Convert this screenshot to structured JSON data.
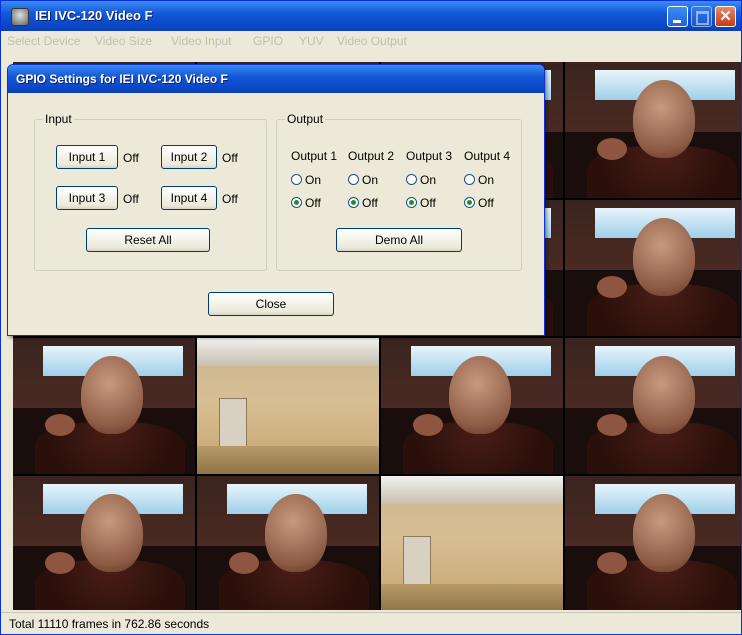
{
  "window": {
    "title": "IEI IVC-120 Video F",
    "close_glyph": "✕"
  },
  "menubar": {
    "items": [
      "Select Device",
      "Video Size",
      "Video Input",
      "GPIO",
      "YUV",
      "Video Output"
    ]
  },
  "dialog": {
    "title": "GPIO Settings for IEI IVC-120 Video F",
    "input_group_label": "Input",
    "output_group_label": "Output",
    "inputs": [
      {
        "label": "Input 1",
        "state": "Off"
      },
      {
        "label": "Input 2",
        "state": "Off"
      },
      {
        "label": "Input 3",
        "state": "Off"
      },
      {
        "label": "Input 4",
        "state": "Off"
      }
    ],
    "reset_all_label": "Reset All",
    "outputs": [
      {
        "label": "Output 1",
        "on_label": "On",
        "off_label": "Off",
        "selected": "Off"
      },
      {
        "label": "Output 2",
        "on_label": "On",
        "off_label": "Off",
        "selected": "Off"
      },
      {
        "label": "Output 3",
        "on_label": "On",
        "off_label": "Off",
        "selected": "Off"
      },
      {
        "label": "Output 4",
        "on_label": "On",
        "off_label": "Off",
        "selected": "Off"
      }
    ],
    "demo_all_label": "Demo All",
    "close_label": "Close"
  },
  "status": {
    "text": "Total 11110 frames in 762.86 seconds"
  },
  "colors": {
    "titlebar": "#0a48c8",
    "face": "#ece9d8"
  }
}
